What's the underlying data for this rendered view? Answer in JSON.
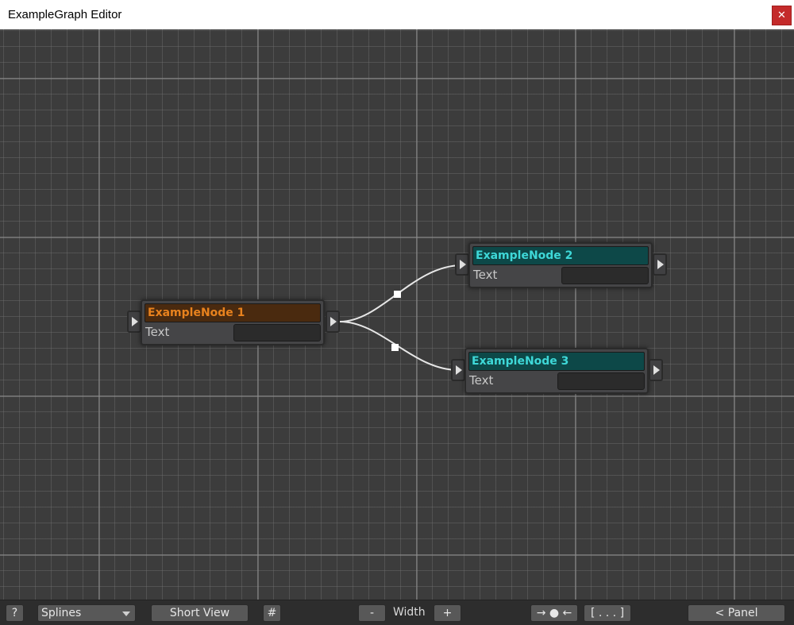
{
  "window": {
    "title": "ExampleGraph Editor",
    "close_label": "✕"
  },
  "nodes": [
    {
      "title": "ExampleNode 1",
      "field_label": "Text",
      "field_value": "",
      "color": "#e8821e"
    },
    {
      "title": "ExampleNode 2",
      "field_label": "Text",
      "field_value": "",
      "color": "#3ed8d8"
    },
    {
      "title": "ExampleNode 3",
      "field_label": "Text",
      "field_value": "",
      "color": "#3ed8d8"
    }
  ],
  "toolbar": {
    "help_label": "?",
    "mode_select": "Splines",
    "short_view_label": "Short View",
    "grid_label": "#",
    "width_minus_label": "-",
    "width_label": "Width",
    "width_plus_label": "+",
    "center_label": "→ ● ←",
    "fit_label": "[ . . . ]",
    "panel_label": "< Panel"
  },
  "colors": {
    "canvas": "#3c3c3c",
    "orange_header": "#4a2a0f",
    "teal_header": "#0d4848",
    "close": "#c42b2b"
  }
}
